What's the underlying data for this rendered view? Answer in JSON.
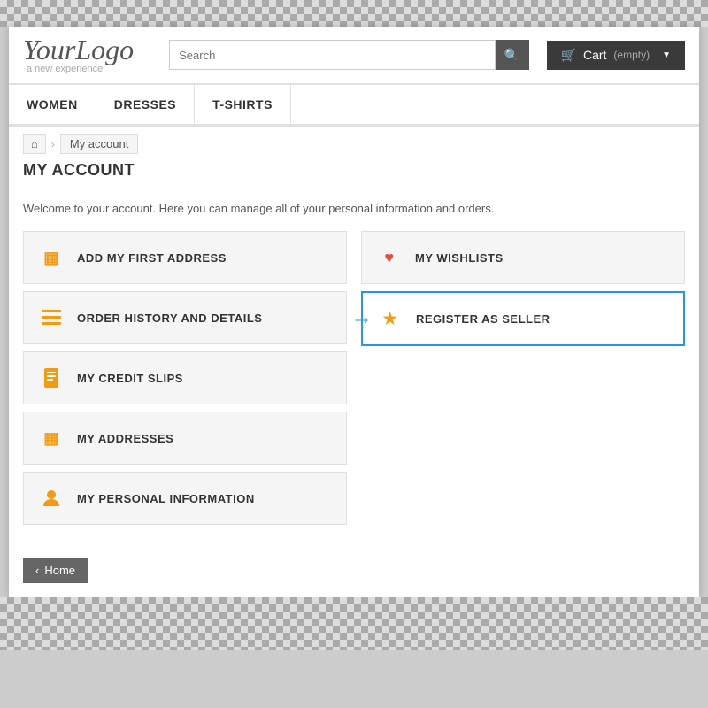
{
  "header": {
    "logo": "YourLogo",
    "tagline": "a new experience",
    "search_placeholder": "Search",
    "cart_label": "Cart",
    "cart_status": "(empty)"
  },
  "nav": {
    "items": [
      "WOMEN",
      "DRESSES",
      "T-SHIRTS"
    ]
  },
  "breadcrumb": {
    "home_icon": "⌂",
    "separator": "›",
    "current": "My account"
  },
  "page": {
    "title": "MY ACCOUNT",
    "welcome": "Welcome to your account. Here you can manage all of your personal information and orders."
  },
  "left_buttons": [
    {
      "icon": "▦",
      "label": "ADD MY FIRST ADDRESS"
    },
    {
      "icon": "≡",
      "label": "ORDER HISTORY AND DETAILS"
    },
    {
      "icon": "□",
      "label": "MY CREDIT SLIPS"
    },
    {
      "icon": "▦",
      "label": "MY ADDRESSES"
    },
    {
      "icon": "👤",
      "label": "MY PERSONAL INFORMATION"
    }
  ],
  "right_buttons": [
    {
      "icon": "♥",
      "label": "MY WISHLISTS"
    },
    {
      "icon": "★",
      "label": "REGISTER AS SELLER",
      "highlighted": true
    }
  ],
  "footer": {
    "home_label": "Home",
    "back_arrow": "‹"
  }
}
